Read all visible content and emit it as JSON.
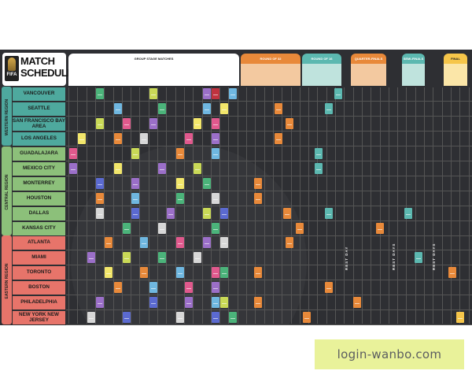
{
  "title": {
    "line1": "MATCH",
    "line2": "SCHEDULE",
    "logo_text": "FIFA"
  },
  "headers": {
    "group_stage": "GROUP STAGE MATCHES",
    "round32": "ROUND OF 32",
    "round16": "ROUND OF 16",
    "quarter": "QUARTER-FINALS",
    "semi": "SEMI-FINALS",
    "final": "FINAL"
  },
  "regions": [
    {
      "name": "WESTERN REGION",
      "color": "#4ea99e",
      "cities": [
        "VANCOUVER",
        "SEATTLE",
        "SAN FRANCISCO BAY AREA",
        "LOS ANGELES"
      ]
    },
    {
      "name": "CENTRAL REGION",
      "color": "#8cc07a",
      "cities": [
        "GUADALAJARA",
        "MEXICO CITY",
        "MONTERREY",
        "HOUSTON",
        "DALLAS",
        "KANSAS CITY"
      ]
    },
    {
      "name": "EASTERN REGION",
      "color": "#e7746a",
      "cities": [
        "ATLANTA",
        "MIAMI",
        "TORONTO",
        "BOSTON",
        "PHILADELPHIA",
        "NEW YORK NEW JERSEY"
      ]
    }
  ],
  "rest_days": [
    "REST DAY",
    "REST DAYS",
    "REST DAYS"
  ],
  "colors": {
    "background": "#2e2f33",
    "knockout": "#e8893a",
    "round16": "#5cb8b0"
  },
  "watermark": "login-wanbo.com"
}
